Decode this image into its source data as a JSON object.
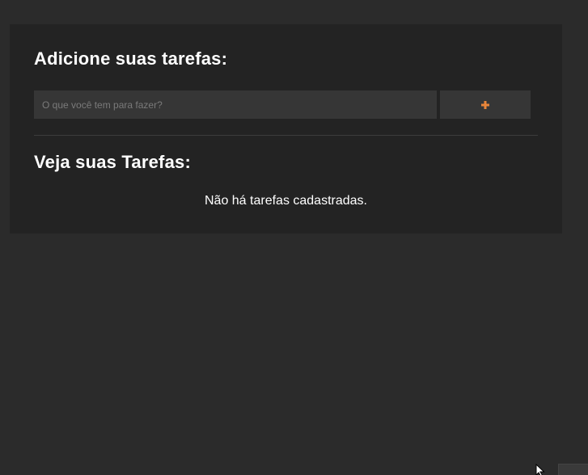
{
  "add_section": {
    "title": "Adicione suas tarefas:",
    "input_placeholder": "O que você tem para fazer?",
    "input_value": "",
    "add_button_icon": "plus-icon"
  },
  "list_section": {
    "title": "Veja suas Tarefas:",
    "empty_message": "Não há tarefas cadastradas."
  },
  "colors": {
    "page_background": "#2b2b2b",
    "card_background": "#232323",
    "input_background": "#363636",
    "accent_plus": "#e8853a",
    "text": "#ffffff"
  }
}
